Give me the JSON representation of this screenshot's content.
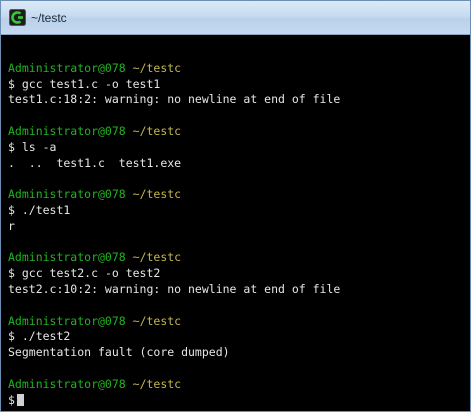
{
  "window": {
    "title": "~/testc",
    "icon": "cygwin-terminal-icon"
  },
  "colors": {
    "background": "#000000",
    "text": "#e6e6e6",
    "prompt_user": "#21b321",
    "prompt_path": "#c2b64a"
  },
  "prompt": {
    "user": "Administrator@078",
    "path": "~/testc",
    "symbol": "$"
  },
  "blocks": [
    {
      "command": " gcc test1.c -o test1",
      "output": [
        "test1.c:18:2: warning: no newline at end of file"
      ]
    },
    {
      "command": " ls -a",
      "output": [
        ".  ..  test1.c  test1.exe"
      ]
    },
    {
      "command": " ./test1",
      "output": [
        "r"
      ]
    },
    {
      "command": " gcc test2.c -o test2",
      "output": [
        "test2.c:10:2: warning: no newline at end of file"
      ]
    },
    {
      "command": " ./test2",
      "output": [
        "Segmentation fault (core dumped)"
      ]
    }
  ],
  "final_prompt": {
    "command": ""
  }
}
